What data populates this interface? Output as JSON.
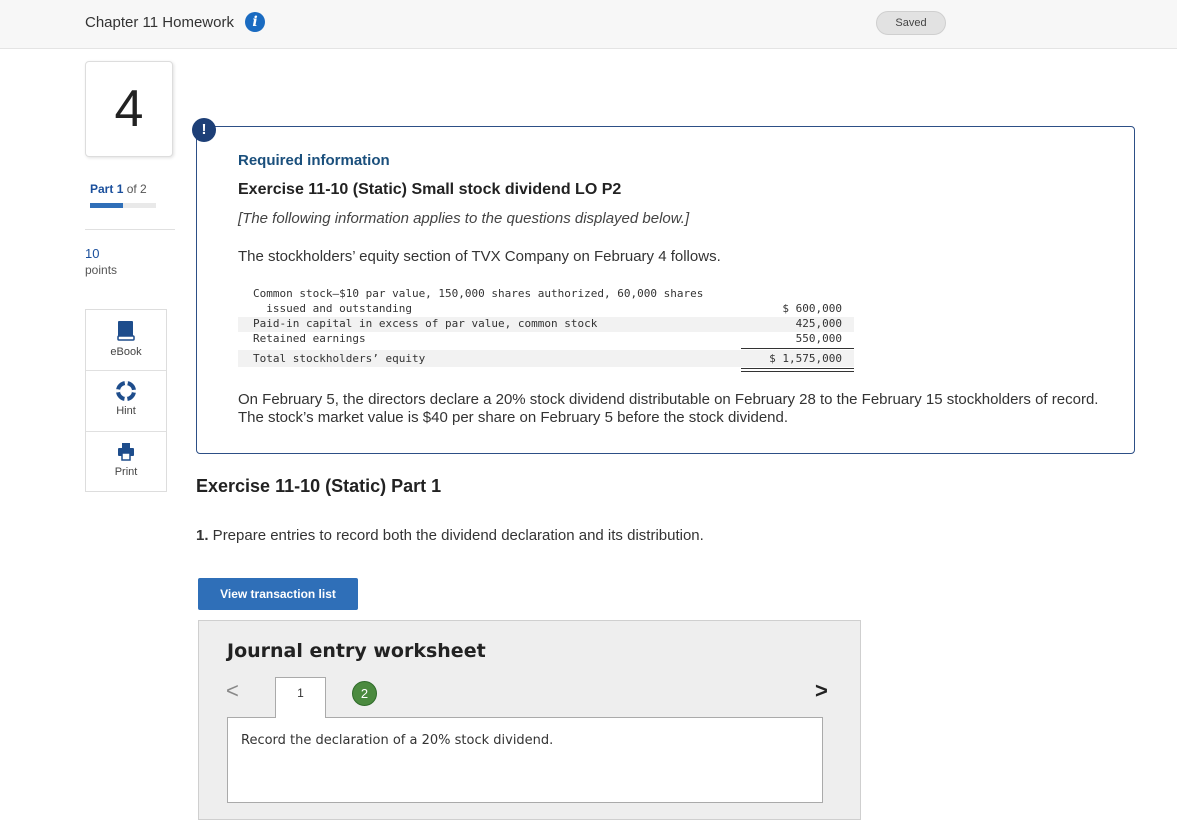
{
  "header": {
    "chapter_title": "Chapter 11 Homework",
    "info_icon": "info-icon",
    "saved_label": "Saved"
  },
  "sidebar": {
    "question_number": "4",
    "part_word": "Part",
    "part_current": "1",
    "part_of": "of 2",
    "part_progress": 0.5,
    "points_value": "10",
    "points_label": "points",
    "tools": [
      {
        "label": "eBook",
        "icon": "book-icon"
      },
      {
        "label": "Hint",
        "icon": "lifebuoy-icon"
      },
      {
        "label": "Print",
        "icon": "printer-icon"
      }
    ]
  },
  "info": {
    "alert_icon": "!",
    "required_label": "Required information",
    "exercise_title": "Exercise 11-10 (Static) Small stock dividend LO P2",
    "italic_note": "[The following information applies to the questions displayed below.]",
    "intro": "The stockholders’ equity section of TVX Company on February 4 follows.",
    "equity_rows": [
      {
        "label": "Common stock—$10 par value, 150,000 shares authorized, 60,000 shares",
        "value": ""
      },
      {
        "label": "  issued and outstanding",
        "value": "$ 600,000"
      },
      {
        "label": "Paid-in capital in excess of par value, common stock",
        "value": "425,000"
      },
      {
        "label": "Retained earnings",
        "value": "550,000"
      },
      {
        "label": "Total stockholders’ equity",
        "value": "$ 1,575,000"
      }
    ],
    "paragraph": "On February 5, the directors declare a 20% stock dividend distributable on February 28 to the February 15 stockholders of record. The stock’s market value is $40 per share on February 5 before the stock dividend."
  },
  "main": {
    "part_heading": "Exercise 11-10 (Static) Part 1",
    "instruction_number": "1.",
    "instruction_text": " Prepare entries to record both the dividend declaration and its distribution.",
    "view_button_label": "View transaction list"
  },
  "worksheet": {
    "title": "Journal entry worksheet",
    "prev_arrow": "<",
    "next_arrow": ">",
    "current_step": "1",
    "next_step": "2",
    "step_text": "Record the declaration of a 20% stock dividend."
  }
}
